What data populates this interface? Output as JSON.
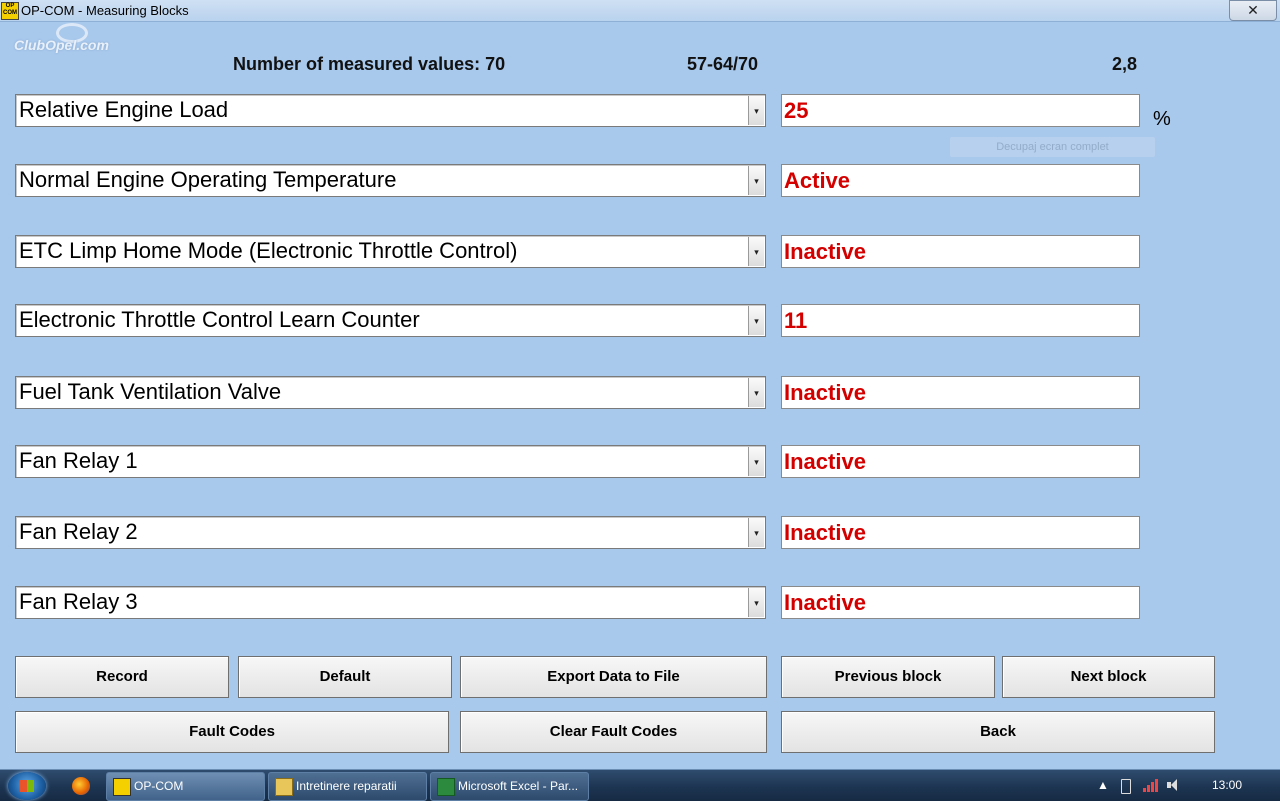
{
  "window": {
    "title": "OP-COM - Measuring Blocks",
    "close_label": "✕",
    "app_icon_text": "OP COM"
  },
  "watermark": "ClubOpel.com",
  "header": {
    "measured_count": "Number of measured values: 70",
    "block_range": "57-64/70",
    "rate": "2,8"
  },
  "rows": [
    {
      "label": "Relative Engine Load",
      "value": "25"
    },
    {
      "label": "Normal Engine Operating Temperature",
      "value": "Active"
    },
    {
      "label": "ETC Limp Home Mode (Electronic Throttle Control)",
      "value": "Inactive"
    },
    {
      "label": "Electronic Throttle Control Learn Counter",
      "value": "11"
    },
    {
      "label": "Fuel Tank Ventilation Valve",
      "value": "Inactive"
    },
    {
      "label": "Fan Relay 1",
      "value": "Inactive"
    },
    {
      "label": "Fan Relay 2",
      "value": "Inactive"
    },
    {
      "label": "Fan Relay 3",
      "value": "Inactive"
    }
  ],
  "unit_row1": "%",
  "dropdown_arrow": "▾",
  "ghost_overlay": "Decupaj ecran complet",
  "buttons": {
    "record": "Record",
    "default": "Default",
    "export": "Export Data to File",
    "previous_block": "Previous block",
    "next_block": "Next block",
    "fault_codes": "Fault Codes",
    "clear_fault_codes": "Clear Fault Codes",
    "back": "Back"
  },
  "taskbar": {
    "items": [
      {
        "label": "OP-COM",
        "icon": "opcom-icon"
      },
      {
        "label": "Intretinere reparatii",
        "icon": "folder-icon"
      },
      {
        "label": "Microsoft Excel - Par...",
        "icon": "excel-icon"
      }
    ],
    "tray": {
      "show_hidden": "▲",
      "clock": "13:00"
    }
  },
  "colors": {
    "background": "#a8c8ec",
    "value_text": "#d40000",
    "taskbar": "#1d3552"
  }
}
